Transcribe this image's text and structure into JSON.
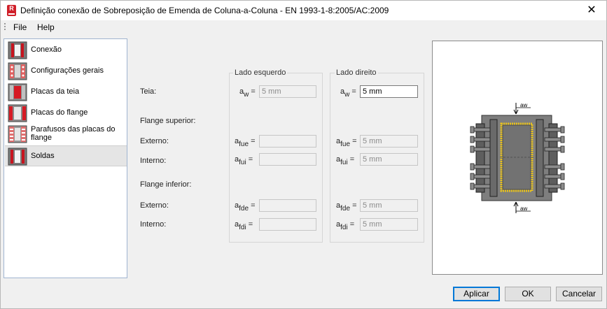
{
  "window": {
    "title": "Definição conexão de Sobreposição de Emenda de Coluna-a-Coluna - EN 1993-1-8:2005/AC:2009",
    "close_glyph": "✕",
    "app_icon": "robot-app-icon",
    "app_icon_letter": "R"
  },
  "menu": {
    "file": "File",
    "help": "Help"
  },
  "nav": {
    "items": [
      {
        "label": "Conexão",
        "icon": "connection-icon"
      },
      {
        "label": "Configurações gerais",
        "icon": "general-settings-icon"
      },
      {
        "label": "Placas da teia",
        "icon": "web-plates-icon"
      },
      {
        "label": "Placas do flange",
        "icon": "flange-plates-icon"
      },
      {
        "label": "Parafusos das placas do flange",
        "icon": "flange-bolts-icon"
      },
      {
        "label": "Soldas",
        "icon": "welds-icon",
        "selected": true
      }
    ]
  },
  "form": {
    "group_left": "Lado esquerdo",
    "group_right": "Lado direito",
    "teia_label": "Teia:",
    "flange_superior_label": "Flange superior:",
    "externo_label": "Externo:",
    "interno_label": "Interno:",
    "flange_inferior_label": "Flange inferior:",
    "externo2_label": "Externo:",
    "interno2_label": "Interno:",
    "sym": {
      "a": "a",
      "w": "w",
      "fue": "fue",
      "fui": "fui",
      "fde": "fde",
      "fdi": "fdi",
      "eq": "="
    },
    "left": {
      "aw": "5 mm",
      "afue": "",
      "afui": "",
      "afde": "",
      "afdi": ""
    },
    "right": {
      "aw": "5 mm",
      "afue": "5 mm",
      "afui": "5 mm",
      "afde": "5 mm",
      "afdi": "5 mm"
    }
  },
  "preview": {
    "weld_label_top": "aw",
    "weld_label_bottom": "aw"
  },
  "buttons": {
    "apply": "Aplicar",
    "ok": "OK",
    "cancel": "Cancelar"
  },
  "colors": {
    "accent": "#0078d7",
    "weld": "#e8c21c",
    "plate": "#6a6a6a",
    "nav_border": "#a0b4d0"
  }
}
